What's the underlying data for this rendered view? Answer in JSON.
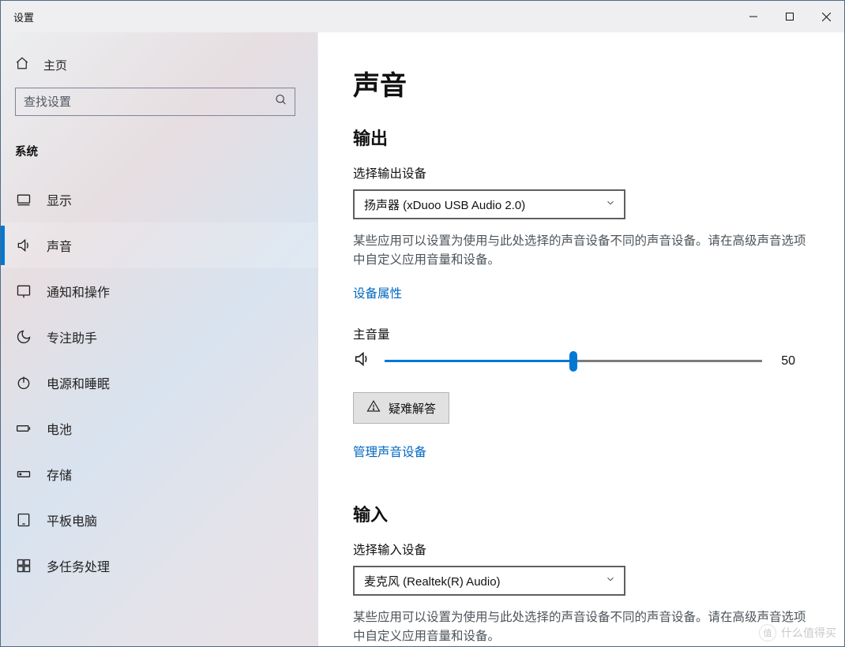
{
  "titlebar": {
    "title": "设置"
  },
  "sidebar": {
    "home_label": "主页",
    "search_placeholder": "查找设置",
    "group_label": "系统",
    "items": [
      {
        "key": "display",
        "label": "显示"
      },
      {
        "key": "sound",
        "label": "声音"
      },
      {
        "key": "notifications",
        "label": "通知和操作"
      },
      {
        "key": "focus",
        "label": "专注助手"
      },
      {
        "key": "power",
        "label": "电源和睡眠"
      },
      {
        "key": "battery",
        "label": "电池"
      },
      {
        "key": "storage",
        "label": "存储"
      },
      {
        "key": "tablet",
        "label": "平板电脑"
      },
      {
        "key": "multitask",
        "label": "多任务处理"
      }
    ]
  },
  "content": {
    "page_title": "声音",
    "output": {
      "section_title": "输出",
      "device_label": "选择输出设备",
      "device_value": "扬声器 (xDuoo USB Audio 2.0)",
      "desc": "某些应用可以设置为使用与此处选择的声音设备不同的声音设备。请在高级声音选项中自定义应用音量和设备。",
      "device_props_link": "设备属性",
      "volume_label": "主音量",
      "volume_value": "50",
      "troubleshoot_label": "疑难解答",
      "manage_link": "管理声音设备"
    },
    "input": {
      "section_title": "输入",
      "device_label": "选择输入设备",
      "device_value": "麦克风 (Realtek(R) Audio)",
      "desc": "某些应用可以设置为使用与此处选择的声音设备不同的声音设备。请在高级声音选项中自定义应用音量和设备。"
    }
  },
  "watermark": {
    "badge": "值",
    "text": "什么值得买"
  },
  "colors": {
    "accent": "#0078d4",
    "link": "#0067c0"
  }
}
